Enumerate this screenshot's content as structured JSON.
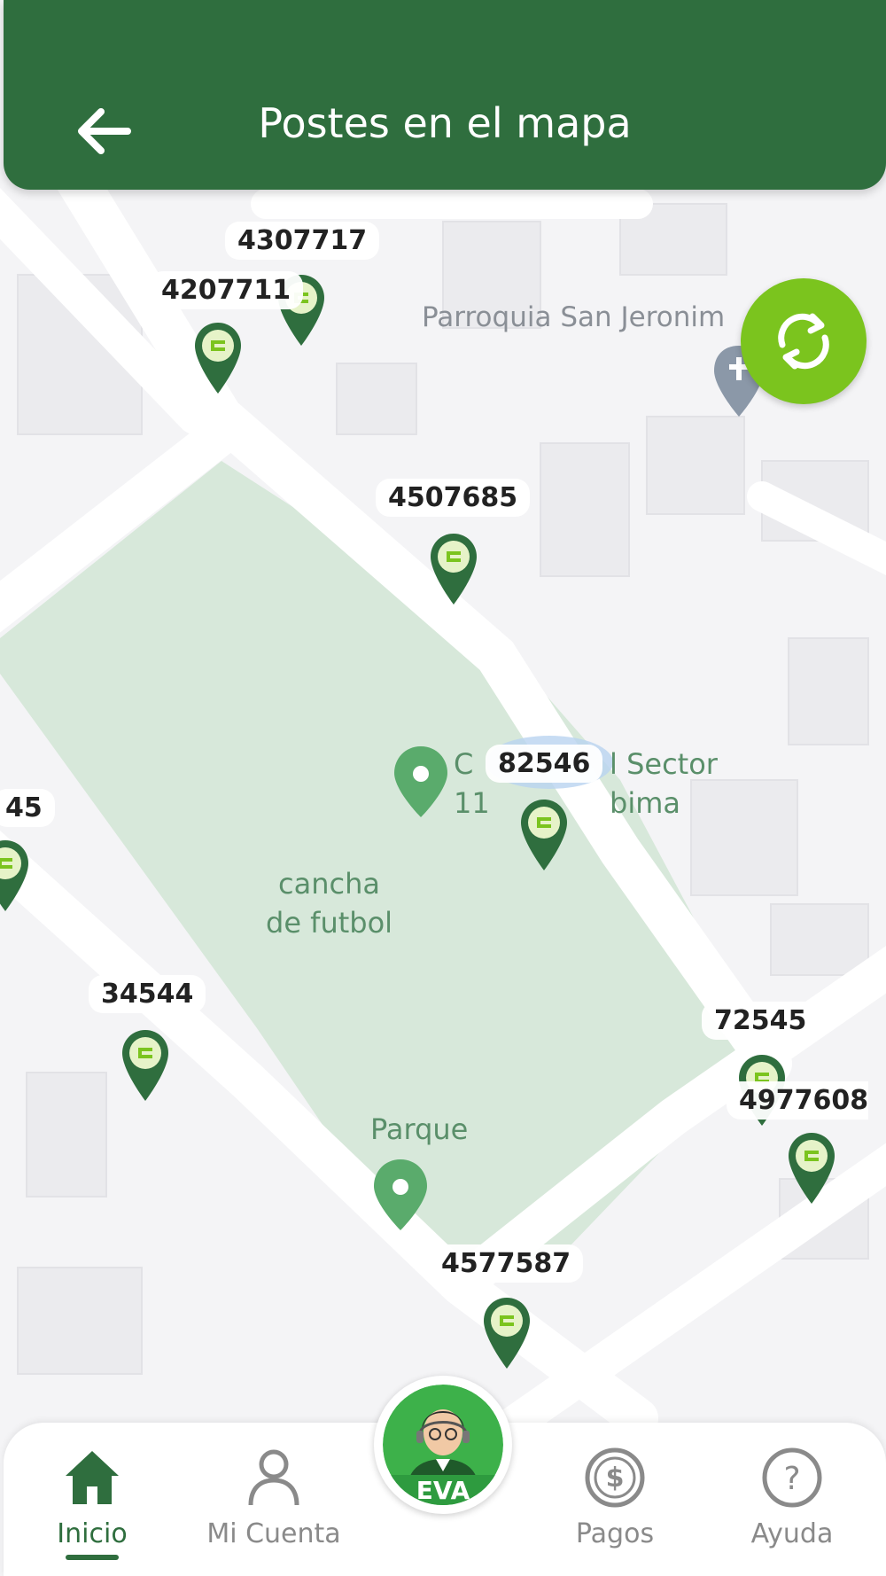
{
  "header": {
    "title": "Postes en el mapa",
    "back_icon": "arrow-left-icon"
  },
  "colors": {
    "brand_green": "#2f6e3e",
    "accent_green": "#7bc41e",
    "park_green": "#d7e8da",
    "map_bg": "#f4f4f6"
  },
  "map": {
    "poles": [
      "4307717",
      "4207711",
      "4507685",
      "82546",
      "45",
      "34544",
      "72545",
      "4977608",
      "4577587"
    ],
    "places": {
      "cancha": "cancha\nde futbol",
      "parque": "Parque",
      "parroquia": "Parroquia San Jeronim",
      "sector_left": "C\n11",
      "sector_right": "l Sector\nbima"
    }
  },
  "refresh": {
    "icon": "refresh-icon"
  },
  "nav": {
    "items": [
      {
        "label": "Inicio",
        "icon": "home-icon"
      },
      {
        "label": "Mi Cuenta",
        "icon": "user-icon"
      },
      {
        "label": "Pagos",
        "icon": "dollar-icon"
      },
      {
        "label": "Ayuda",
        "icon": "help-icon"
      }
    ],
    "eva_label": "EVA"
  }
}
